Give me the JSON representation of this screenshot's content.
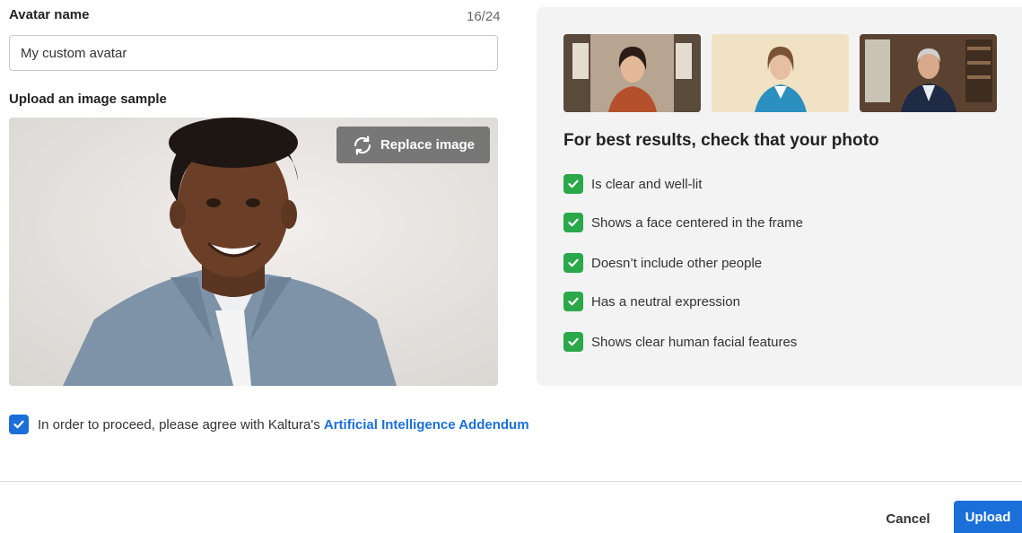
{
  "form": {
    "avatar_name_label": "Avatar name",
    "char_counter": "16/24",
    "avatar_name_value": "My custom avatar",
    "upload_label": "Upload an image sample",
    "replace_button_label": "Replace image"
  },
  "tips": {
    "title": "For best results, check that your photo",
    "items": [
      {
        "label": "Is clear and well-lit",
        "checked": true
      },
      {
        "label": "Shows a face centered in the frame",
        "checked": true
      },
      {
        "label": "Doesn’t include other people",
        "checked": true
      },
      {
        "label": "Has a neutral expression",
        "checked": true
      },
      {
        "label": "Shows clear human facial features",
        "checked": true
      }
    ]
  },
  "agreement": {
    "checked": true,
    "text": "In order to proceed, please agree with Kaltura's",
    "link_text": "Artificial Intelligence Addendum"
  },
  "footer": {
    "cancel_label": "Cancel",
    "upload_label": "Upload"
  },
  "colors": {
    "accent": "#1a6fd9",
    "check_green": "#2aa84a",
    "panel_bg": "#f3f3f3"
  },
  "icons": {
    "replace": "refresh-icon",
    "tip_check": "check-icon",
    "agree_check": "check-icon"
  }
}
